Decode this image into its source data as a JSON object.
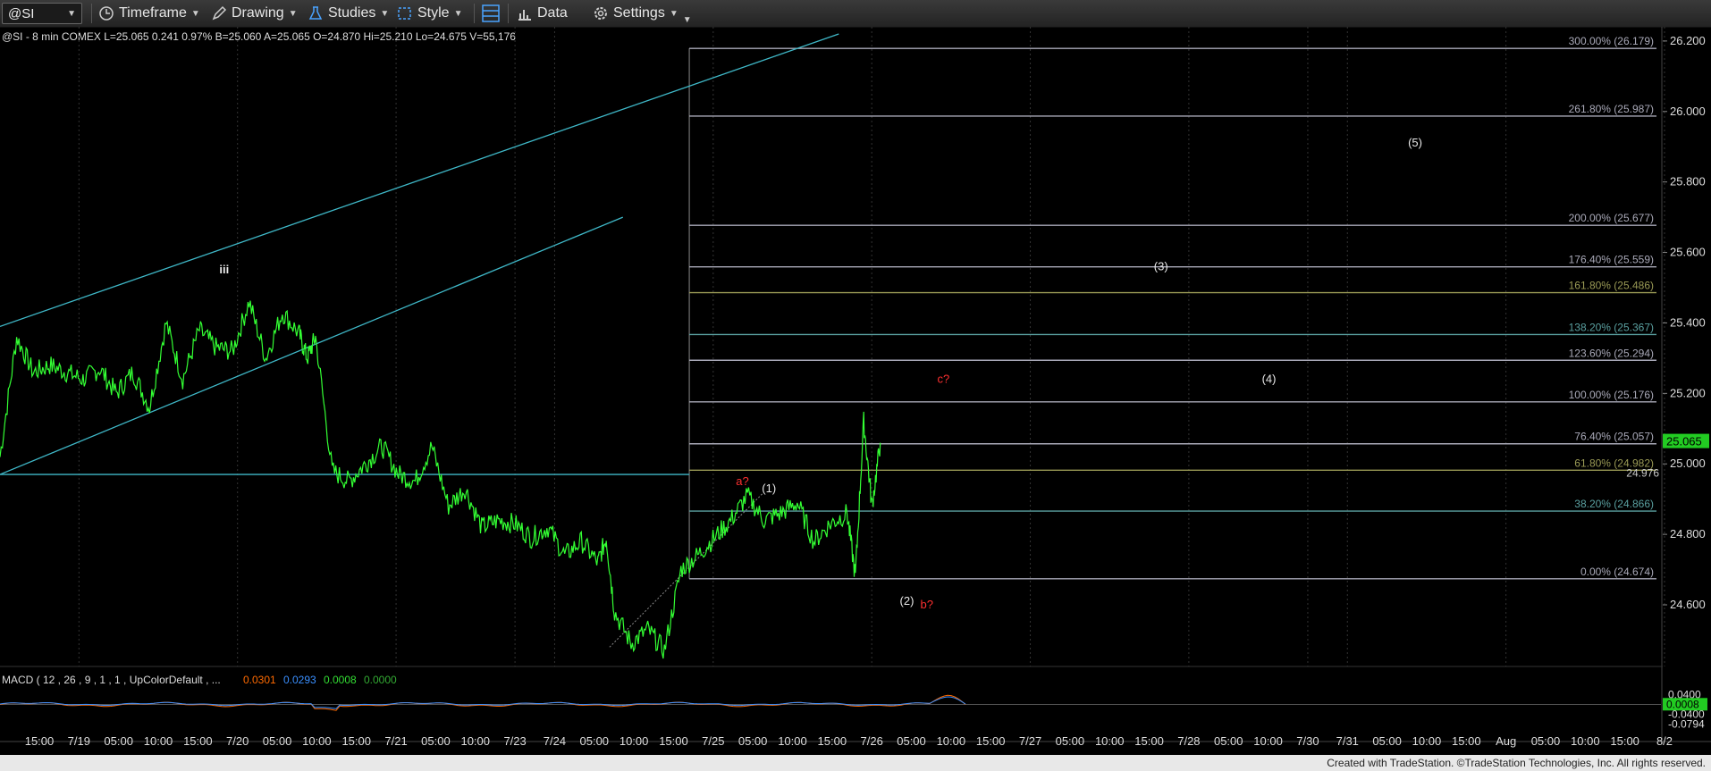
{
  "toolbar": {
    "symbol": "@SI",
    "items": [
      {
        "label": "Timeframe",
        "icon": "clock-icon"
      },
      {
        "label": "Drawing",
        "icon": "pencil-icon"
      },
      {
        "label": "Studies",
        "icon": "flask-icon"
      },
      {
        "label": "Style",
        "icon": "style-icon"
      },
      {
        "label": "",
        "icon": "layout-icon"
      },
      {
        "label": "Data",
        "icon": "bar-chart-icon"
      },
      {
        "label": "Settings",
        "icon": "gear-icon"
      }
    ]
  },
  "colors": {
    "price": "#33ff33",
    "channel": "#3fb8c8",
    "fib_gray": "#a9a9b8",
    "fib_olive": "#9a9a55",
    "fib_teal": "#5aa0a0",
    "red_label": "#ff3030",
    "last_price_bg": "#22cc22"
  },
  "chart_data": [
    {
      "type": "line",
      "header": "@SI - 8 min  COMEX  L=25.065  0.241  0.97%  B=25.060  A=25.065  O=24.870  Hi=25.210  Lo=24.675  V=55,176",
      "ylim": [
        24.42,
        26.22
      ],
      "y_ticks": [
        "24.600",
        "24.800",
        "25.000",
        "25.200",
        "25.400",
        "25.600",
        "25.800",
        "26.000",
        "26.200"
      ],
      "x_ticks": [
        "15:00",
        "7/19",
        "05:00",
        "10:00",
        "15:00",
        "7/20",
        "05:00",
        "10:00",
        "15:00",
        "7/21",
        "05:00",
        "10:00",
        "7/23",
        "7/24",
        "05:00",
        "10:00",
        "15:00",
        "7/25",
        "05:00",
        "10:00",
        "15:00",
        "7/26",
        "05:00",
        "10:00",
        "15:00",
        "7/27",
        "05:00",
        "10:00",
        "15:00",
        "7/28",
        "05:00",
        "10:00",
        "7/30",
        "7/31",
        "05:00",
        "10:00",
        "15:00",
        "Aug",
        "05:00",
        "10:00",
        "15:00",
        "8/2"
      ],
      "series": [
        {
          "x": [
            0,
            0.01,
            0.02,
            0.03,
            0.04,
            0.05,
            0.06,
            0.07,
            0.08,
            0.09,
            0.1,
            0.11,
            0.12,
            0.13,
            0.14,
            0.15,
            0.16,
            0.17,
            0.18,
            0.185,
            0.19,
            0.2,
            0.21,
            0.22,
            0.23,
            0.24,
            0.25,
            0.26,
            0.27,
            0.28,
            0.29,
            0.3,
            0.31,
            0.32,
            0.33,
            0.34,
            0.35,
            0.36,
            0.365,
            0.37,
            0.38,
            0.39,
            0.4,
            0.41,
            0.42,
            0.43,
            0.44,
            0.45,
            0.46,
            0.47,
            0.48,
            0.49,
            0.5,
            0.51,
            0.515,
            0.52,
            0.525,
            0.53
          ],
          "values": [
            25.02,
            25.36,
            25.26,
            25.28,
            25.26,
            25.24,
            25.27,
            25.2,
            25.26,
            25.16,
            25.4,
            25.24,
            25.38,
            25.33,
            25.32,
            25.46,
            25.3,
            25.43,
            25.37,
            25.3,
            25.36,
            24.98,
            24.95,
            25.0,
            25.05,
            24.97,
            24.95,
            25.05,
            24.88,
            24.93,
            24.82,
            24.84,
            24.83,
            24.79,
            24.82,
            24.74,
            24.78,
            24.72,
            24.79,
            24.58,
            24.49,
            24.53,
            24.47,
            24.7,
            24.74,
            24.79,
            24.84,
            24.91,
            24.84,
            24.86,
            24.89,
            24.78,
            24.83,
            24.86,
            24.68,
            25.12,
            24.88,
            25.06
          ]
        }
      ],
      "channel_lines": [
        {
          "x": [
            0.0,
            0.505
          ],
          "values": [
            25.39,
            26.22
          ]
        },
        {
          "x": [
            0.0,
            0.375
          ],
          "values": [
            24.97,
            25.7
          ]
        },
        {
          "x": [
            0.0,
            0.415
          ],
          "values": [
            24.97,
            24.97
          ]
        }
      ],
      "fib_levels": [
        {
          "label": "300.00% (26.179)",
          "value": 26.179,
          "color": "gray"
        },
        {
          "label": "261.80% (25.987)",
          "value": 25.987,
          "color": "gray"
        },
        {
          "label": "200.00% (25.677)",
          "value": 25.677,
          "color": "gray"
        },
        {
          "label": "176.40% (25.559)",
          "value": 25.559,
          "color": "gray"
        },
        {
          "label": "161.80% (25.486)",
          "value": 25.486,
          "color": "olive"
        },
        {
          "label": "138.20% (25.367)",
          "value": 25.367,
          "color": "teal"
        },
        {
          "label": "123.60% (25.294)",
          "value": 25.294,
          "color": "gray"
        },
        {
          "label": "100.00% (25.176)",
          "value": 25.176,
          "color": "gray"
        },
        {
          "label": "76.40% (25.057)",
          "value": 25.057,
          "color": "gray"
        },
        {
          "label": "61.80% (24.982)",
          "value": 24.982,
          "color": "olive"
        },
        {
          "label": "38.20% (24.866)",
          "value": 24.866,
          "color": "teal"
        },
        {
          "label": "0.00% (24.674)",
          "value": 24.674,
          "color": "gray"
        }
      ],
      "wave_labels": [
        {
          "text": "iii",
          "x": 0.135,
          "y": 25.54,
          "color": "white"
        },
        {
          "text": "a?",
          "x": 0.447,
          "y": 24.94,
          "color": "red"
        },
        {
          "text": "(1)",
          "x": 0.463,
          "y": 24.92,
          "color": "white"
        },
        {
          "text": "(2)",
          "x": 0.546,
          "y": 24.6,
          "color": "white"
        },
        {
          "text": "b?",
          "x": 0.558,
          "y": 24.59,
          "color": "red"
        },
        {
          "text": "c?",
          "x": 0.568,
          "y": 25.23,
          "color": "red"
        },
        {
          "text": "(3)",
          "x": 0.699,
          "y": 25.55,
          "color": "white"
        },
        {
          "text": "(4)",
          "x": 0.764,
          "y": 25.23,
          "color": "white"
        },
        {
          "text": "(5)",
          "x": 0.852,
          "y": 25.9,
          "color": "white"
        }
      ],
      "last_price_tag": "25.065",
      "level_tag": "24.976"
    },
    {
      "type": "line",
      "header": "MACD ( 12 , 26 , 9 , 1 , 1 , UpColorDefault , ...",
      "legend_values": [
        {
          "text": "0.0301",
          "color": "#ff6a00"
        },
        {
          "text": "0.0293",
          "color": "#3a8fff"
        },
        {
          "text": "0.0008",
          "color": "#33dd33"
        },
        {
          "text": "0.0000",
          "color": "#33aa33"
        }
      ],
      "ylim": [
        -0.1,
        0.06
      ],
      "y_ticks": [
        "0.0400",
        "-0.0400",
        "-0.0794"
      ],
      "last_value_tag": "0.0008"
    }
  ],
  "footer": {
    "credit": "Created with TradeStation. ©TradeStation Technologies, Inc. All rights reserved."
  }
}
